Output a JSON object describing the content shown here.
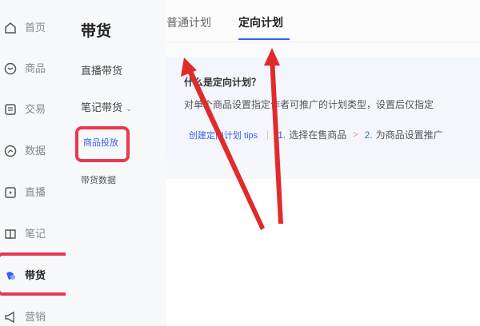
{
  "sidebar": {
    "items": [
      {
        "label": "首页",
        "icon": "home-icon"
      },
      {
        "label": "商品",
        "icon": "product-icon"
      },
      {
        "label": "交易",
        "icon": "trade-icon"
      },
      {
        "label": "数据",
        "icon": "data-icon"
      },
      {
        "label": "直播",
        "icon": "live-icon"
      },
      {
        "label": "笔记",
        "icon": "notes-icon"
      },
      {
        "label": "带货",
        "icon": "goods-icon",
        "active": true
      },
      {
        "label": "营销",
        "icon": "marketing-icon"
      }
    ]
  },
  "subnav": {
    "title": "带货",
    "items": [
      {
        "label": "直播带货"
      },
      {
        "label": "笔记带货"
      },
      {
        "label": "商品投放",
        "active": true
      },
      {
        "label": "带货数据"
      }
    ]
  },
  "tabs": [
    {
      "label": "普通计划"
    },
    {
      "label": "定向计划",
      "active": true
    }
  ],
  "info": {
    "title": "什么是定向计划？",
    "description": "对单个商品设置指定作者可推广的计划类型，设置后仅指定",
    "tips_link": "创建定向计划 tips",
    "steps": [
      {
        "num": "1.",
        "label": "选择在售商品"
      },
      {
        "num": "2.",
        "label": "为商品设置推广"
      }
    ]
  },
  "colors": {
    "accent": "#3662ec",
    "highlight": "#e8384f"
  }
}
